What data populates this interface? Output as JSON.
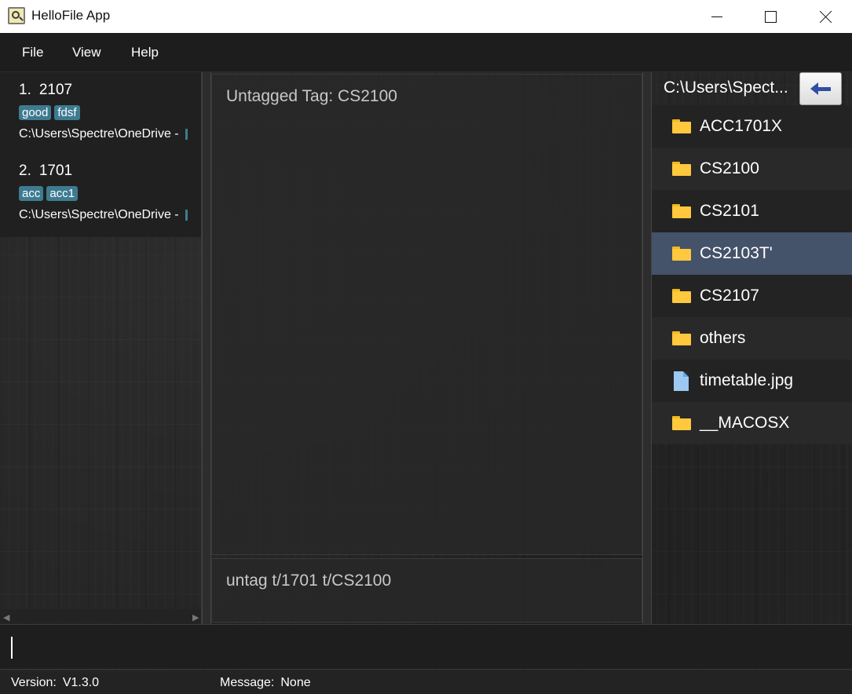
{
  "window": {
    "title": "HelloFile App"
  },
  "menu": {
    "file": "File",
    "view": "View",
    "help": "Help"
  },
  "tagged_list": [
    {
      "index": "1.",
      "name": "2107",
      "tags": [
        "good",
        "fdsf"
      ],
      "path": "C:\\Users\\Spectre\\OneDrive - "
    },
    {
      "index": "2.",
      "name": "1701",
      "tags": [
        "acc",
        "acc1"
      ],
      "path": "C:\\Users\\Spectre\\OneDrive - "
    }
  ],
  "result": {
    "text": "Untagged Tag: CS2100"
  },
  "last_command": {
    "text": "untag t/1701 t/CS2100"
  },
  "browser": {
    "current_path": "C:\\Users\\Spectre\\OneDrive",
    "current_path_display": "C:\\Users\\Spect...",
    "items": [
      {
        "name": "ACC1701X",
        "type": "folder"
      },
      {
        "name": "CS2100",
        "type": "folder"
      },
      {
        "name": "CS2101",
        "type": "folder"
      },
      {
        "name": "CS2103T'",
        "type": "folder",
        "selected": true
      },
      {
        "name": "CS2107",
        "type": "folder"
      },
      {
        "name": "others",
        "type": "folder"
      },
      {
        "name": "timetable.jpg",
        "type": "file"
      },
      {
        "name": "__MACOSX",
        "type": "folder"
      }
    ]
  },
  "command_box": {
    "value": ""
  },
  "status": {
    "version_label": "Version:",
    "version_value": "V1.3.0",
    "message_label": "Message:",
    "message_value": "None"
  },
  "colors": {
    "accent": "#3e7b91",
    "selected_row": "#44526a",
    "folder": "#ffc83d",
    "back_arrow": "#2f4fa3"
  }
}
